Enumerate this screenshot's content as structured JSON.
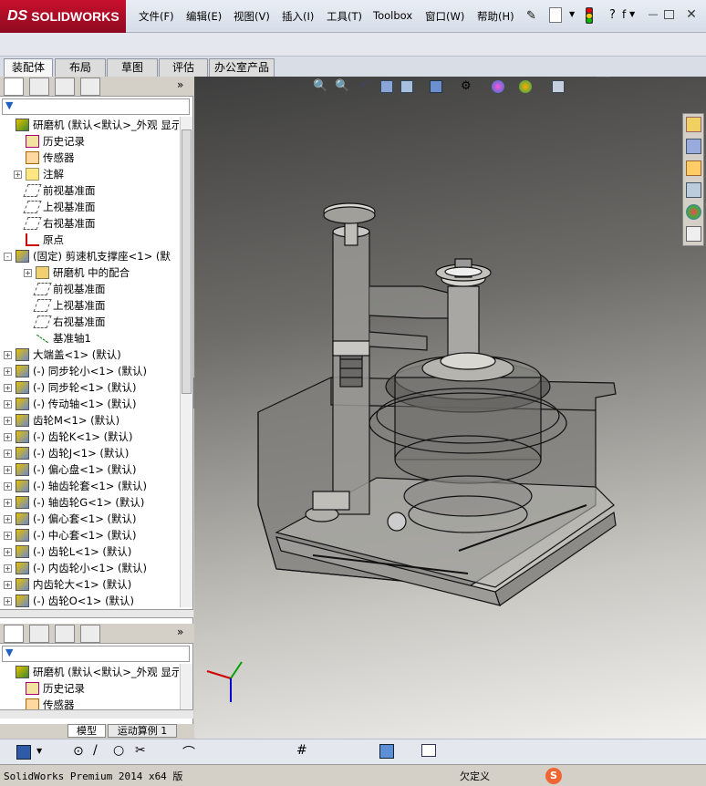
{
  "app": {
    "brand": "SOLIDWORKS",
    "brand_prefix": "DS"
  },
  "menu": [
    {
      "label": "文件(F)"
    },
    {
      "label": "编辑(E)"
    },
    {
      "label": "视图(V)"
    },
    {
      "label": "插入(I)"
    },
    {
      "label": "工具(T)"
    },
    {
      "label": "Toolbox"
    },
    {
      "label": "窗口(W)"
    },
    {
      "label": "帮助(H)"
    }
  ],
  "command_tabs": [
    {
      "label": "装配体",
      "active": true
    },
    {
      "label": "布局"
    },
    {
      "label": "草图"
    },
    {
      "label": "评估"
    },
    {
      "label": "办公室产品"
    }
  ],
  "feature_tree": {
    "rows": [
      {
        "label": "研磨机   (默认<默认>_外观 显示",
        "indent": 0,
        "expander": "",
        "icon": "assembly-icon"
      },
      {
        "label": "历史记录",
        "indent": 1,
        "expander": "",
        "icon": "history-icon"
      },
      {
        "label": "传感器",
        "indent": 1,
        "expander": "",
        "icon": "sensor-icon"
      },
      {
        "label": "注解",
        "indent": 1,
        "expander": "+",
        "icon": "annotation-icon"
      },
      {
        "label": "前视基准面",
        "indent": 1,
        "expander": "",
        "icon": "plane-icon"
      },
      {
        "label": "上视基准面",
        "indent": 1,
        "expander": "",
        "icon": "plane-icon"
      },
      {
        "label": "右视基准面",
        "indent": 1,
        "expander": "",
        "icon": "plane-icon"
      },
      {
        "label": "原点",
        "indent": 1,
        "expander": "",
        "icon": "origin-icon"
      },
      {
        "label": "(固定) 剪速机支撑座<1> (默",
        "indent": 0,
        "expander": "-",
        "icon": "part-icon"
      },
      {
        "label": "研磨机 中的配合",
        "indent": 2,
        "expander": "+",
        "icon": "mates-icon"
      },
      {
        "label": "前视基准面",
        "indent": 2,
        "expander": "",
        "icon": "plane-icon"
      },
      {
        "label": "上视基准面",
        "indent": 2,
        "expander": "",
        "icon": "plane-icon"
      },
      {
        "label": "右视基准面",
        "indent": 2,
        "expander": "",
        "icon": "plane-icon"
      },
      {
        "label": "基准轴1",
        "indent": 2,
        "expander": "",
        "icon": "axis-icon"
      },
      {
        "label": "大端盖<1> (默认)",
        "indent": 0,
        "expander": "+",
        "icon": "part-icon"
      },
      {
        "label": "(-) 同步轮小<1> (默认)",
        "indent": 0,
        "expander": "+",
        "icon": "part-icon"
      },
      {
        "label": "(-) 同步轮<1> (默认)",
        "indent": 0,
        "expander": "+",
        "icon": "part-icon"
      },
      {
        "label": "(-) 传动轴<1> (默认)",
        "indent": 0,
        "expander": "+",
        "icon": "part-icon"
      },
      {
        "label": "齿轮M<1> (默认)",
        "indent": 0,
        "expander": "+",
        "icon": "part-icon"
      },
      {
        "label": "(-) 齿轮K<1> (默认)",
        "indent": 0,
        "expander": "+",
        "icon": "part-icon"
      },
      {
        "label": "(-) 齿轮J<1> (默认)",
        "indent": 0,
        "expander": "+",
        "icon": "part-icon"
      },
      {
        "label": "(-) 偏心盘<1> (默认)",
        "indent": 0,
        "expander": "+",
        "icon": "part-icon"
      },
      {
        "label": "(-) 轴齿轮套<1> (默认)",
        "indent": 0,
        "expander": "+",
        "icon": "part-icon"
      },
      {
        "label": "(-) 轴齿轮G<1> (默认)",
        "indent": 0,
        "expander": "+",
        "icon": "part-icon"
      },
      {
        "label": "(-) 偏心套<1> (默认)",
        "indent": 0,
        "expander": "+",
        "icon": "part-icon"
      },
      {
        "label": "(-) 中心套<1> (默认)",
        "indent": 0,
        "expander": "+",
        "icon": "part-icon"
      },
      {
        "label": "(-) 齿轮L<1> (默认)",
        "indent": 0,
        "expander": "+",
        "icon": "part-icon"
      },
      {
        "label": "(-) 内齿轮小<1> (默认)",
        "indent": 0,
        "expander": "+",
        "icon": "part-icon"
      },
      {
        "label": "内齿轮大<1> (默认)",
        "indent": 0,
        "expander": "+",
        "icon": "part-icon"
      },
      {
        "label": "(-) 齿轮O<1> (默认)",
        "indent": 0,
        "expander": "+",
        "icon": "part-icon"
      }
    ]
  },
  "feature_tree_2": {
    "rows": [
      {
        "label": "研磨机   (默认<默认>_外观 显示",
        "indent": 0,
        "expander": "",
        "icon": "assembly-icon"
      },
      {
        "label": "历史记录",
        "indent": 1,
        "expander": "",
        "icon": "history-icon"
      },
      {
        "label": "传感器",
        "indent": 1,
        "expander": "",
        "icon": "sensor-icon"
      }
    ]
  },
  "bottom_tabs": [
    {
      "label": "模型"
    },
    {
      "label": "运动算例 1"
    }
  ],
  "status": {
    "product": "SolidWorks Premium 2014 x64 版",
    "state": "欠定义"
  },
  "colors": {
    "brand_red": "#c8102e",
    "tree_icon_yellow": "#e8c000",
    "axis_x": "#d00000",
    "axis_y": "#00a000",
    "axis_z": "#0000d0"
  }
}
